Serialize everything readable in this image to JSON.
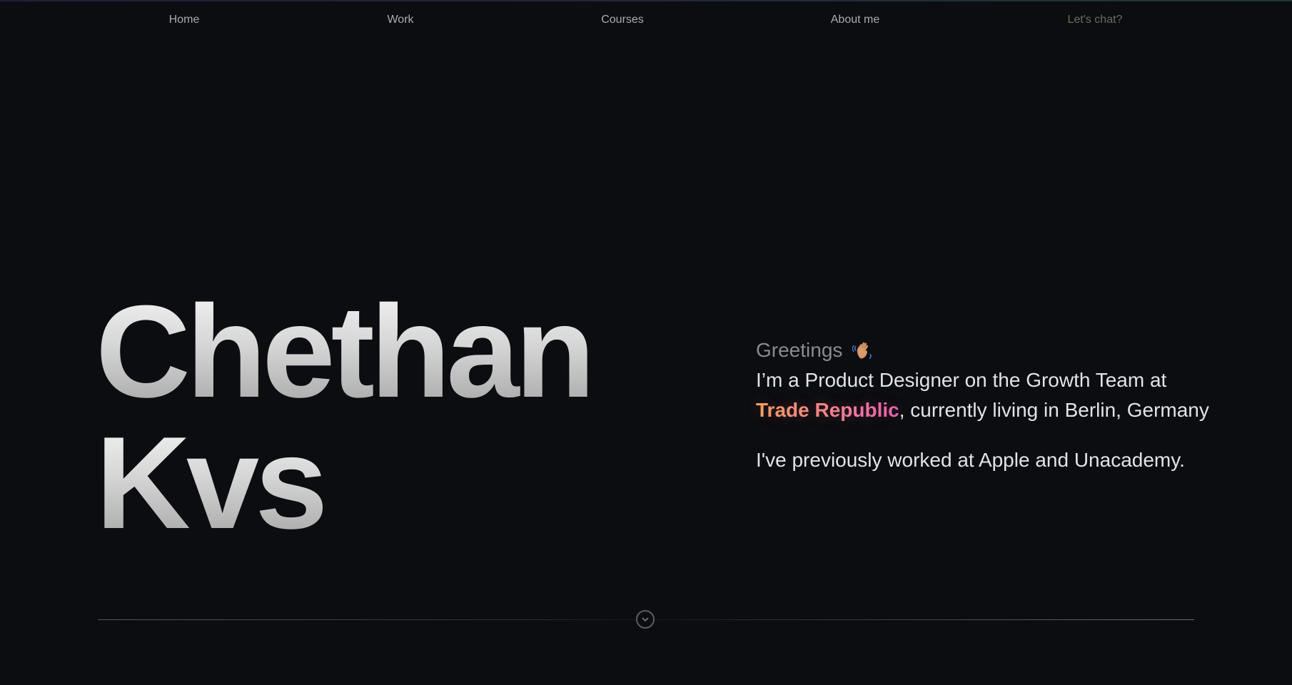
{
  "nav": {
    "items": [
      {
        "label": "Home"
      },
      {
        "label": "Work"
      },
      {
        "label": "Courses"
      },
      {
        "label": "About me"
      }
    ],
    "cta_label": "Let's chat?"
  },
  "hero": {
    "first_name": "Chethan",
    "last_name": "Kvs"
  },
  "intro": {
    "greeting": "Greetings",
    "greeting_icon": "waving-hand-icon",
    "line1_prefix": "I’m a Product Designer on the Growth Team at ",
    "company": "Trade Republic",
    "line1_suffix": ", currently living in Berlin, Germany",
    "line2": "I've previously worked at Apple and Unacademy."
  },
  "scroll": {
    "icon": "chevron-down-icon"
  },
  "colors": {
    "background": "#0c0d10",
    "nav_text": "#a9abaf",
    "cta_text": "#6f6b5d",
    "body_text": "#e2e3e6",
    "greeting_text": "#8a8b8f",
    "brand_gradient_start": "#f6a45a",
    "brand_gradient_end": "#ea5fb5"
  }
}
